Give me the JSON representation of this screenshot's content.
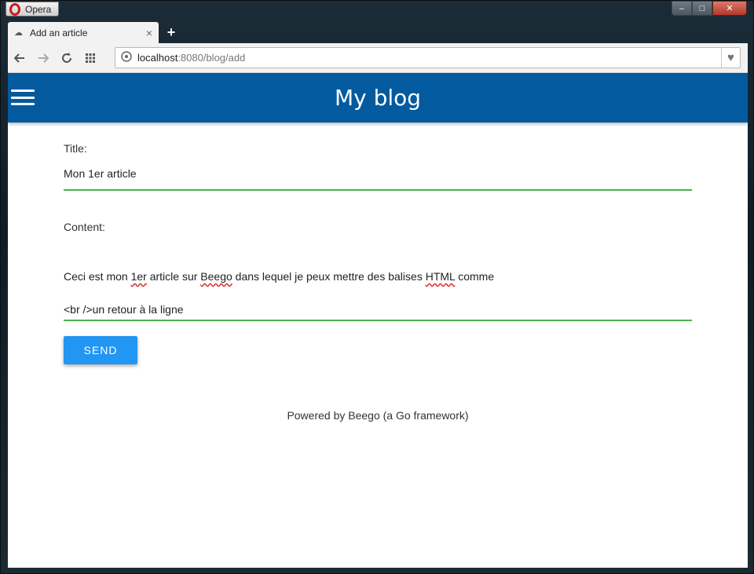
{
  "browser": {
    "menu_label": "Opera",
    "tab_title": "Add an article",
    "tab_close": "×",
    "new_tab": "+",
    "url_host": "localhost",
    "url_rest": ":8080/blog/add",
    "minimize": "–",
    "maximize": "□",
    "close": "✕"
  },
  "appbar": {
    "title": "My blog"
  },
  "form": {
    "title_label": "Title:",
    "title_value": "Mon 1er article",
    "content_label": "Content:",
    "content_line1_a": "Ceci est mon ",
    "content_line1_b": "1er",
    "content_line1_c": " article sur ",
    "content_line1_d": "Beego",
    "content_line1_e": " dans lequel je peux mettre des balises ",
    "content_line1_f": "HTML",
    "content_line1_g": " comme",
    "content_line2": "<br />un retour à la ligne",
    "send_label": "SEND"
  },
  "footer": {
    "text": "Powered by Beego (a Go framework)"
  },
  "colors": {
    "appbar": "#035a9e",
    "button": "#2196f3",
    "underline": "#4caf50"
  }
}
